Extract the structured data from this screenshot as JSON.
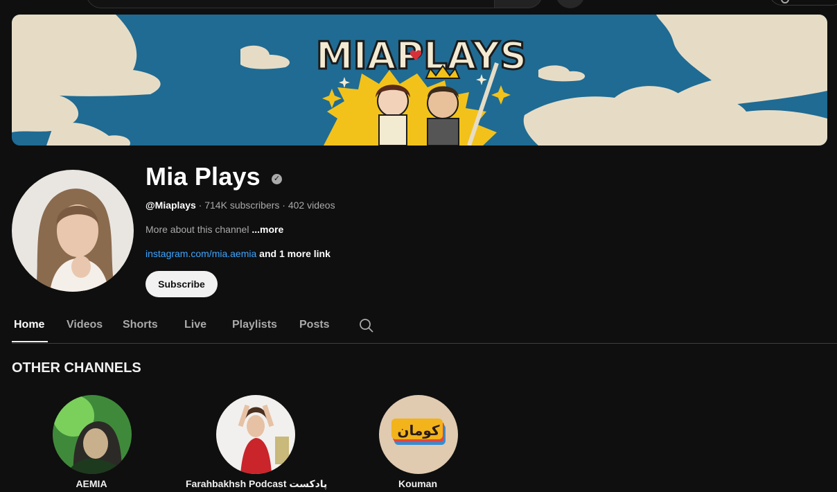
{
  "channel": {
    "name": "Mia Plays",
    "handle": "@Miaplays",
    "subscribers": " · 714K subscribers",
    "videos": " · 402 videos",
    "about": "More about this channel ",
    "about_more": "...more",
    "link": "instagram.com/mia.aemia",
    "link_more": " and 1 more link",
    "subscribe_label": "Subscribe",
    "verified_glyph": "✓",
    "banner_logo": "MIAPLAYS"
  },
  "tabs": [
    {
      "label": "Home",
      "active": true
    },
    {
      "label": "Videos",
      "active": false
    },
    {
      "label": "Shorts",
      "active": false
    },
    {
      "label": "Live",
      "active": false
    },
    {
      "label": "Playlists",
      "active": false
    },
    {
      "label": "Posts",
      "active": false
    }
  ],
  "other_channels": {
    "title": "OTHER CHANNELS",
    "items": [
      {
        "name": "AEMIA"
      },
      {
        "name": "Farahbakhsh Podcast پادکست"
      },
      {
        "name": "Kouman",
        "avatar_text": "کومان"
      }
    ]
  },
  "colors": {
    "background": "#0f0f0f",
    "link": "#3ea6ff",
    "banner_sky": "#1f6b93",
    "banner_clouds": "#e6dcc6",
    "banner_sun": "#f2c21b"
  },
  "icons": {
    "verified": "check-circle-icon",
    "tab_search": "search-icon"
  }
}
